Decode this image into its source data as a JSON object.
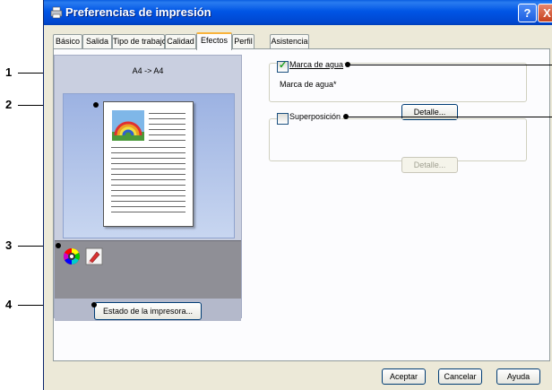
{
  "window": {
    "title": "Preferencias de impresión"
  },
  "tabs": [
    {
      "label": "Básico"
    },
    {
      "label": "Salida"
    },
    {
      "label": "Tipo de trabajo"
    },
    {
      "label": "Calidad"
    },
    {
      "label": "Efectos",
      "active": true
    },
    {
      "label": "Perfil"
    },
    {
      "label": "Asistencia"
    }
  ],
  "callouts": [
    "1",
    "2",
    "3",
    "4"
  ],
  "preview": {
    "paper_size": "A4 -> A4",
    "printer_status_button": "Estado de la impresora..."
  },
  "watermark": {
    "checkbox_label": "Marca de agua",
    "checked": true,
    "field_label": "Marca de agua*",
    "detail_button": "Detalle..."
  },
  "overlay": {
    "checkbox_label": "Superposición",
    "checked": false,
    "detail_button": "Detalle..."
  },
  "buttons": {
    "accept": "Aceptar",
    "cancel": "Cancelar",
    "help": "Ayuda"
  },
  "titlebar_buttons": {
    "help": "?",
    "close": "X"
  },
  "icons": [
    "printer-icon",
    "color-wheel-icon",
    "eraser-icon",
    "rainbow-image-icon",
    "help-icon",
    "close-icon"
  ],
  "colors": {
    "titlebar": "#0055e5",
    "active_tab_accent": "#f9b33c",
    "window_bg": "#ece9d8"
  }
}
